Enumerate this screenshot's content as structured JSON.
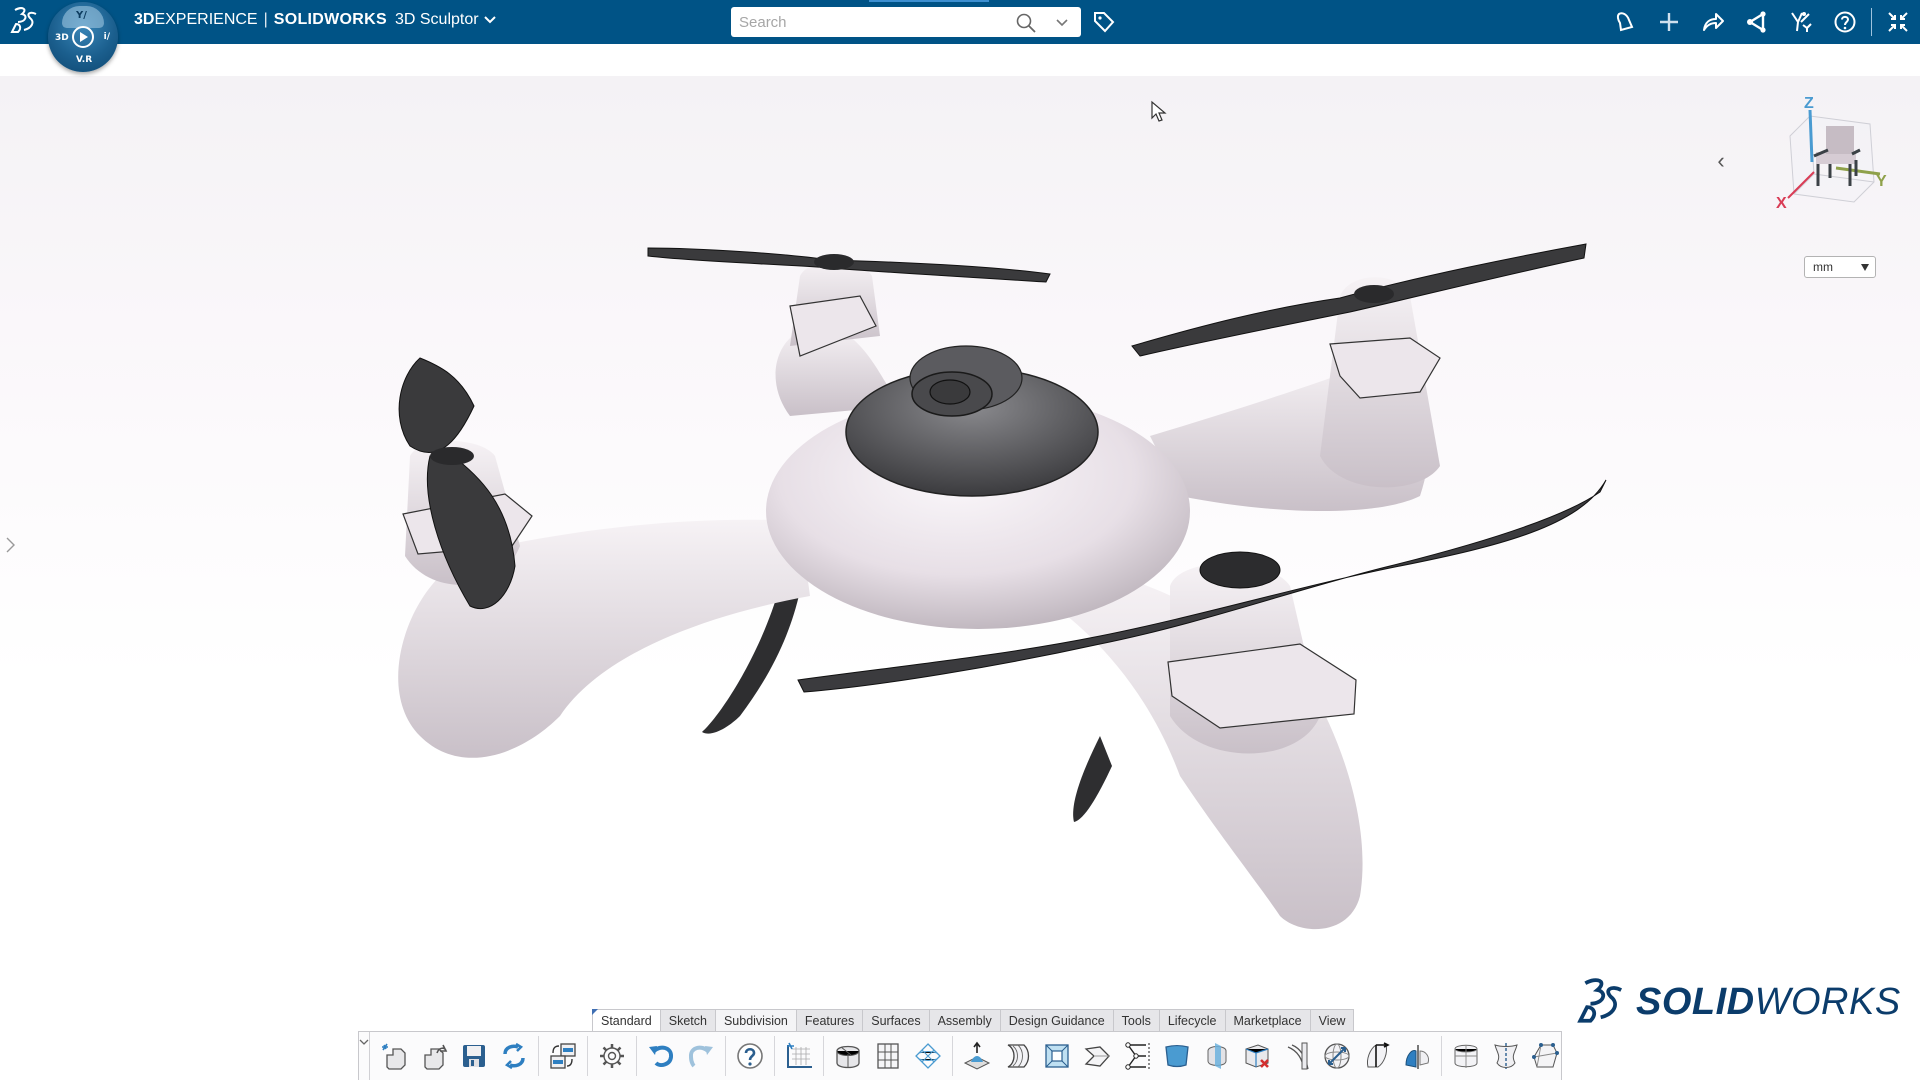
{
  "header": {
    "brand_bold": "3D",
    "brand_rest": "EXPERIENCE",
    "separator": "|",
    "product": "SOLIDWORKS",
    "role": "3D Sculptor",
    "role_chevron": "⌄",
    "compass": {
      "top": "Y/",
      "left": "3D",
      "right": "i/",
      "bottom": "V.R"
    },
    "search": {
      "placeholder": "Search",
      "value": ""
    },
    "icons": [
      "ds-logo-icon",
      "compass-icon",
      "search-icon",
      "search-options-icon",
      "tag-icon",
      "notifications-icon",
      "add-icon",
      "share-icon",
      "social-icon",
      "apps-icon",
      "help-icon",
      "collapse-window-icon"
    ]
  },
  "viewport": {
    "collapse_label": "‹",
    "triad": {
      "x": "X",
      "y": "Y",
      "z": "Z"
    },
    "units": {
      "selected": "mm"
    },
    "logo": {
      "bold": "SOLID",
      "rest": "WORKS"
    },
    "colors": {
      "x_axis": "#d93c56",
      "y_axis": "#8fa14a",
      "z_axis": "#4a9bd1",
      "header": "#005386",
      "model_body": "#efe9ee",
      "propeller": "#3a3a3c"
    }
  },
  "command_manager": {
    "tabs": [
      {
        "label": "Standard",
        "active": true
      },
      {
        "label": "Sketch"
      },
      {
        "label": "Subdivision",
        "highlight": true
      },
      {
        "label": "Features"
      },
      {
        "label": "Surfaces"
      },
      {
        "label": "Assembly"
      },
      {
        "label": "Design Guidance"
      },
      {
        "label": "Tools"
      },
      {
        "label": "Lifecycle"
      },
      {
        "label": "Marketplace"
      },
      {
        "label": "View"
      }
    ],
    "tool_groups": [
      [
        "new-icon",
        "open-icon",
        "save-icon",
        "rebuild-icon"
      ],
      [
        "switch-window-icon"
      ],
      [
        "options-gear-icon"
      ],
      [
        "undo-icon",
        "redo-icon"
      ],
      [
        "help-question-icon"
      ],
      [
        "new-subdivision-sketch-icon"
      ],
      [
        "primitive-icon",
        "grid-mesh-icon",
        "surface-mesh-icon"
      ],
      [
        "pull-icon",
        "bend-icon",
        "inset-icon",
        "extrude-face-icon",
        "symmetry-icon",
        "fill-face-icon",
        "split-icon",
        "delete-face-icon",
        "crease-icon",
        "sphere-transform-icon",
        "align-icon",
        "mirror-icon"
      ],
      [
        "box-primitive-icon",
        "revolve-primitive-icon",
        "cage-icon"
      ]
    ]
  }
}
